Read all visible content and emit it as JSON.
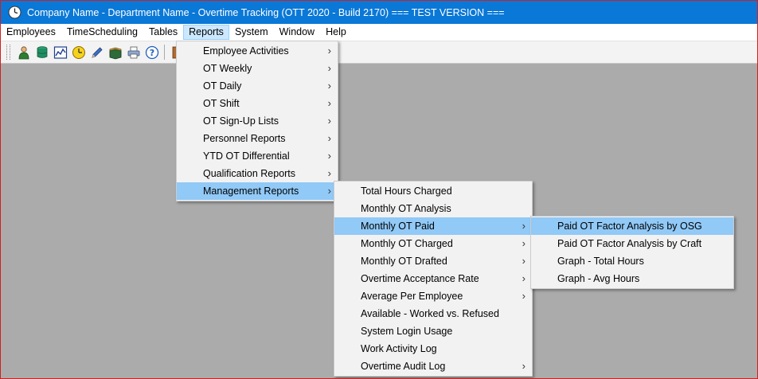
{
  "window": {
    "title": "Company Name - Department Name - Overtime Tracking (OTT 2020 - Build 2170)  === TEST VERSION ==="
  },
  "menubar": {
    "items": [
      "Employees",
      "TimeScheduling",
      "Tables",
      "Reports",
      "System",
      "Window",
      "Help"
    ],
    "active": "Reports"
  },
  "toolbar": {
    "icons": [
      "employee-icon",
      "database-icon",
      "chart-icon",
      "clock-icon",
      "pencil-icon",
      "book-icon",
      "printer-icon",
      "help-icon",
      "exit-icon"
    ]
  },
  "reports_menu": {
    "items": [
      {
        "label": "Employee Activities",
        "submenu": true
      },
      {
        "label": "OT Weekly",
        "submenu": true
      },
      {
        "label": "OT Daily",
        "submenu": true
      },
      {
        "label": "OT Shift",
        "submenu": true
      },
      {
        "label": "OT Sign-Up Lists",
        "submenu": true
      },
      {
        "label": "Personnel Reports",
        "submenu": true
      },
      {
        "label": "YTD OT Differential",
        "submenu": true
      },
      {
        "label": "Qualification Reports",
        "submenu": true
      },
      {
        "label": "Management Reports",
        "submenu": true
      }
    ],
    "highlighted": "Management Reports"
  },
  "management_menu": {
    "items": [
      {
        "label": "Total Hours Charged",
        "submenu": false
      },
      {
        "label": "Monthly OT Analysis",
        "submenu": false
      },
      {
        "label": "Monthly OT Paid",
        "submenu": true
      },
      {
        "label": "Monthly OT Charged",
        "submenu": true
      },
      {
        "label": "Monthly OT Drafted",
        "submenu": true
      },
      {
        "label": "Overtime Acceptance Rate",
        "submenu": true
      },
      {
        "label": "Average Per Employee",
        "submenu": true
      },
      {
        "label": "Available - Worked vs. Refused",
        "submenu": false
      },
      {
        "label": "System Login Usage",
        "submenu": false
      },
      {
        "label": "Work Activity Log",
        "submenu": false
      },
      {
        "label": "Overtime Audit Log",
        "submenu": true
      }
    ],
    "highlighted": "Monthly OT Paid"
  },
  "ot_paid_menu": {
    "items": [
      {
        "label": "Paid OT Factor Analysis by OSG",
        "submenu": false
      },
      {
        "label": "Paid OT Factor Analysis by Craft",
        "submenu": false
      },
      {
        "label": "Graph - Total Hours",
        "submenu": false
      },
      {
        "label": "Graph - Avg Hours",
        "submenu": false
      }
    ],
    "highlighted": "Paid OT Factor Analysis by OSG"
  },
  "colors": {
    "titlebar": "#0a78d7",
    "highlight": "#91c9f7",
    "mdi_background": "#ababab",
    "menu_background": "#f2f2f2"
  }
}
